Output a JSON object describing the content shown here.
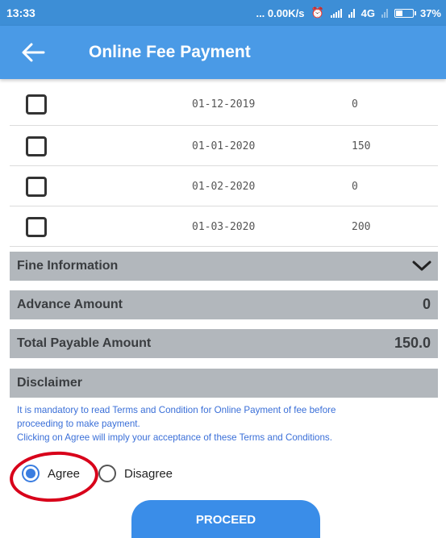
{
  "status_bar": {
    "time": "13:33",
    "speed": "... 0.00K/s",
    "network": "4G",
    "battery": "37%"
  },
  "app_bar": {
    "title": "Online Fee Payment",
    "back_icon": "arrow-left-icon"
  },
  "fee_rows": [
    {
      "date": "01-12-2019",
      "amount": "0",
      "checked": false
    },
    {
      "date": "01-01-2020",
      "amount": "150",
      "checked": false
    },
    {
      "date": "01-02-2020",
      "amount": "0",
      "checked": false
    },
    {
      "date": "01-03-2020",
      "amount": "200",
      "checked": false
    }
  ],
  "fine_information": {
    "label": "Fine Information",
    "icon": "chevron-down-icon"
  },
  "advance_amount": {
    "label": "Advance Amount",
    "value": "0"
  },
  "total_payable": {
    "label": "Total Payable Amount",
    "value": "150.0"
  },
  "disclaimer": {
    "label": "Disclaimer",
    "text_line1": "It is mandatory to read Terms and Condition for Online Payment of fee before",
    "text_line2": "proceeding to make payment.",
    "text_line3": "Clicking on Agree will imply your acceptance of these Terms and Conditions."
  },
  "consent": {
    "agree_label": "Agree",
    "disagree_label": "Disagree",
    "selected": "agree"
  },
  "proceed_label": "PROCEED",
  "colors": {
    "status_bar": "#3d8ed6",
    "app_bar": "#4a9ae6",
    "section_bar": "#b2b7bc",
    "disclaimer_text": "#3a6fd8",
    "radio_selected": "#3a7de0",
    "proceed_button": "#3a8de8",
    "highlight_ring": "#d8001a"
  }
}
